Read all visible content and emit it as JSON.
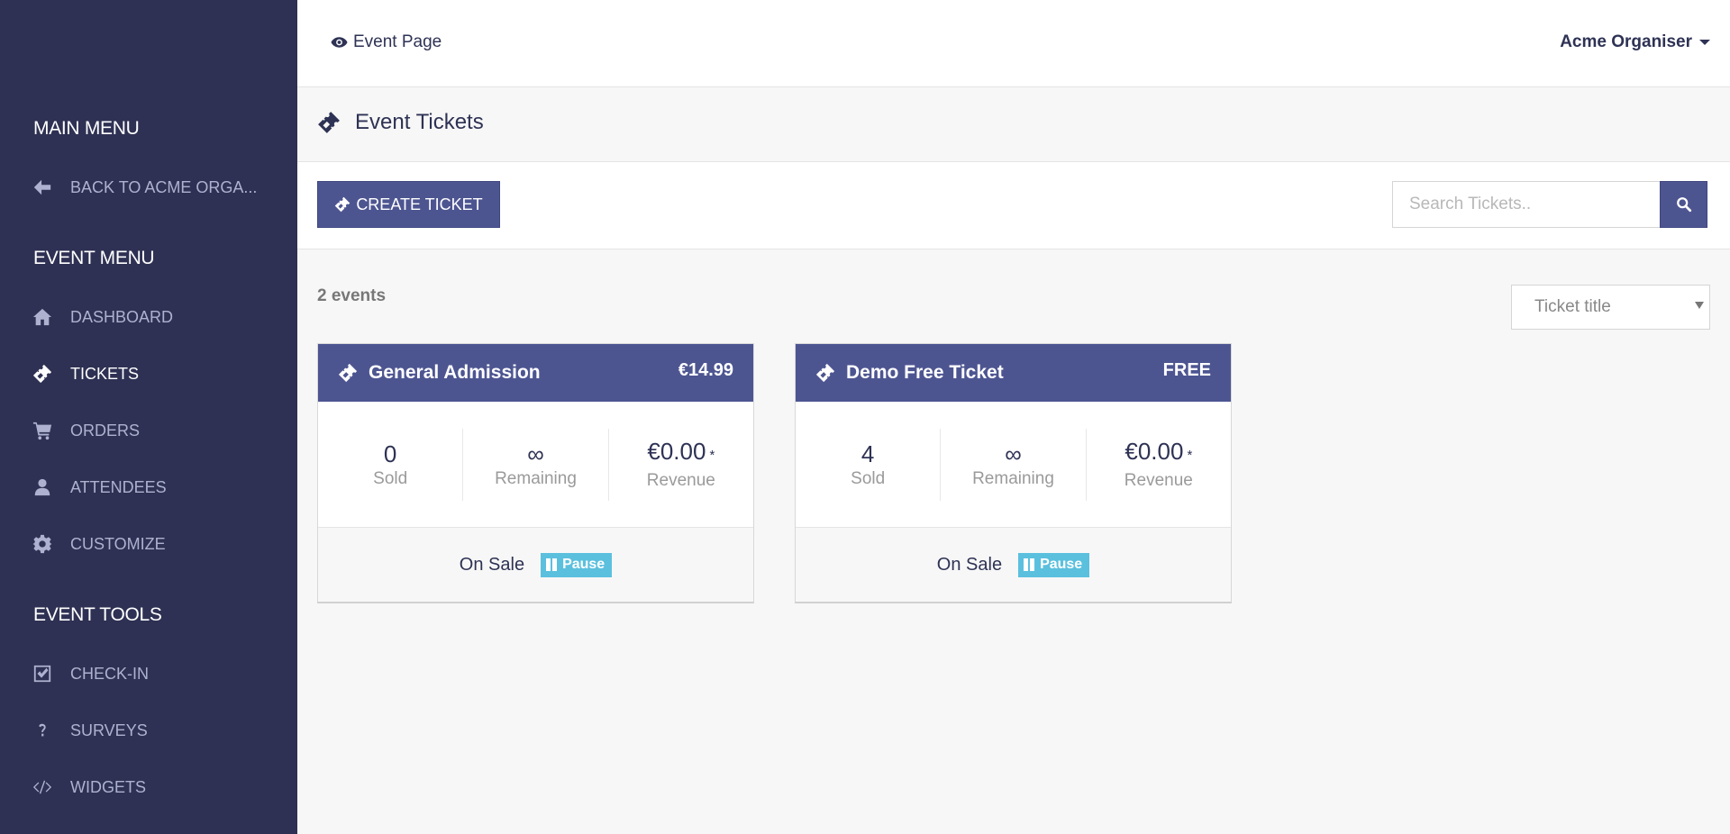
{
  "sidebar": {
    "main_menu_heading": "MAIN MENU",
    "back_label": "BACK TO ACME ORGA...",
    "event_menu_heading": "EVENT MENU",
    "event_items": [
      {
        "label": "DASHBOARD",
        "icon": "home-icon"
      },
      {
        "label": "TICKETS",
        "icon": "ticket-icon",
        "active": true
      },
      {
        "label": "ORDERS",
        "icon": "cart-icon"
      },
      {
        "label": "ATTENDEES",
        "icon": "user-icon"
      },
      {
        "label": "CUSTOMIZE",
        "icon": "gear-icon"
      }
    ],
    "event_tools_heading": "EVENT TOOLS",
    "tool_items": [
      {
        "label": "CHECK-IN",
        "icon": "checkbox-icon"
      },
      {
        "label": "SURVEYS",
        "icon": "question-icon"
      },
      {
        "label": "WIDGETS",
        "icon": "code-icon"
      }
    ]
  },
  "topbar": {
    "event_page_label": "Event Page",
    "organiser_label": "Acme Organiser"
  },
  "page": {
    "title": "Event Tickets"
  },
  "toolbar": {
    "create_label": "CREATE TICKET",
    "search_placeholder": "Search Tickets.."
  },
  "listing": {
    "count_label": "2 events",
    "sort_selected": "Ticket title"
  },
  "tickets": [
    {
      "title": "General Admission",
      "price": "€14.99",
      "sold": "0",
      "sold_label": "Sold",
      "remaining": "∞",
      "remaining_label": "Remaining",
      "revenue": "€0.00",
      "revenue_mark": "*",
      "revenue_label": "Revenue",
      "status": "On Sale",
      "pause_label": "Pause"
    },
    {
      "title": "Demo Free Ticket",
      "price": "FREE",
      "sold": "4",
      "sold_label": "Sold",
      "remaining": "∞",
      "remaining_label": "Remaining",
      "revenue": "€0.00",
      "revenue_mark": "*",
      "revenue_label": "Revenue",
      "status": "On Sale",
      "pause_label": "Pause"
    }
  ],
  "colors": {
    "sidebar_bg": "#2e3153",
    "accent": "#4d5591",
    "pause": "#5bc0de"
  }
}
